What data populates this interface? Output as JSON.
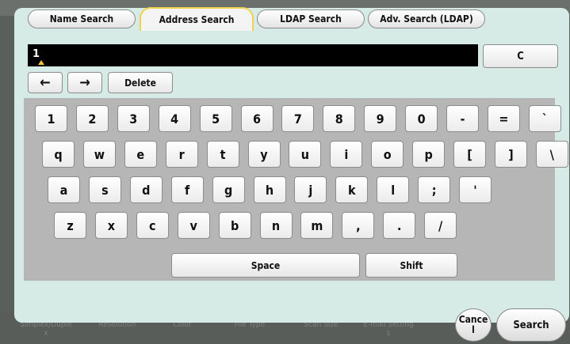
{
  "tabs": [
    {
      "label": "Name Search",
      "active": false
    },
    {
      "label": "Address Search",
      "active": true
    },
    {
      "label": "LDAP Search",
      "active": false
    },
    {
      "label": "Adv. Search (LDAP)",
      "active": false
    }
  ],
  "input": {
    "value": "1"
  },
  "clear_label": "C",
  "nav": {
    "left_icon": "←",
    "right_icon": "→",
    "delete_label": "Delete"
  },
  "keyboard": {
    "rows": [
      [
        "1",
        "2",
        "3",
        "4",
        "5",
        "6",
        "7",
        "8",
        "9",
        "0",
        "-",
        "=",
        "`"
      ],
      [
        "q",
        "w",
        "e",
        "r",
        "t",
        "y",
        "u",
        "i",
        "o",
        "p",
        "[",
        "]",
        "\\"
      ],
      [
        "a",
        "s",
        "d",
        "f",
        "g",
        "h",
        "j",
        "k",
        "l",
        ";",
        "'"
      ],
      [
        "z",
        "x",
        "c",
        "v",
        "b",
        "n",
        "m",
        ",",
        ".",
        "/"
      ]
    ],
    "space_label": "Space",
    "shift_label": "Shift"
  },
  "actions": {
    "cancel_label": "Cance\nl",
    "search_label": "Search"
  },
  "background_menu": [
    "Simplex/Duple\nx",
    "Resolution",
    "Color",
    "File Type",
    "Scan Size",
    "E-mail Setting\ns"
  ],
  "colors": {
    "panel": "#d7ebe6",
    "keyboard_bg": "#b6b6b6",
    "active_tab_border": "#f2d44a",
    "caret": "#f2c43a"
  }
}
